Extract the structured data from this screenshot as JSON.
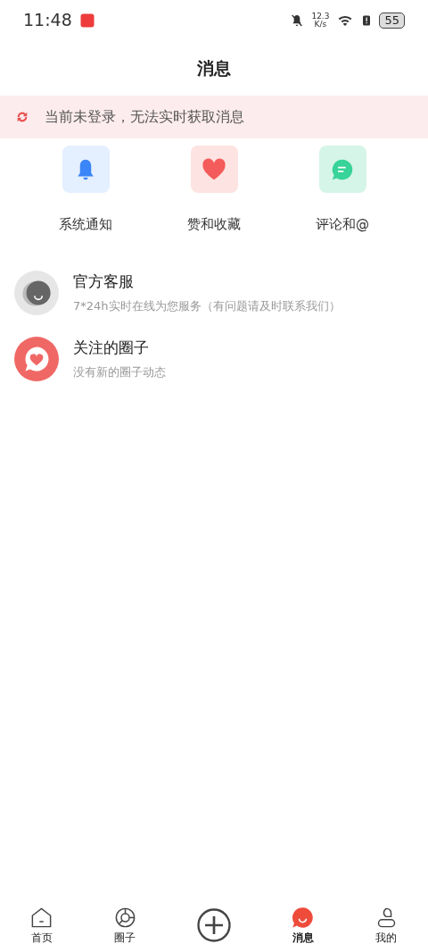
{
  "status_bar": {
    "time": "11:48",
    "speed_value": "12.3",
    "speed_unit": "K/s",
    "battery": "55"
  },
  "title": "消息",
  "banner": {
    "text": "当前未登录，无法实时获取消息"
  },
  "quick_actions": [
    {
      "kind": "bell",
      "label": "系统通知",
      "color": "#3a85f7"
    },
    {
      "kind": "heart",
      "label": "赞和收藏",
      "color": "#f45b5b"
    },
    {
      "kind": "comment",
      "label": "评论和@",
      "color": "#37d399"
    }
  ],
  "conversations": [
    {
      "kind": "service",
      "title": "官方客服",
      "subtitle": "7*24h实时在线为您服务（有问题请及时联系我们）"
    },
    {
      "kind": "circle",
      "title": "关注的圈子",
      "subtitle": "没有新的圈子动态"
    }
  ],
  "tab_bar": [
    {
      "kind": "home",
      "label": "首页",
      "selected": false
    },
    {
      "kind": "circle",
      "label": "圈子",
      "selected": false
    },
    {
      "kind": "plus",
      "selected": false
    },
    {
      "kind": "message",
      "label": "消息",
      "selected": true
    },
    {
      "kind": "me",
      "label": "我的",
      "selected": false
    }
  ]
}
